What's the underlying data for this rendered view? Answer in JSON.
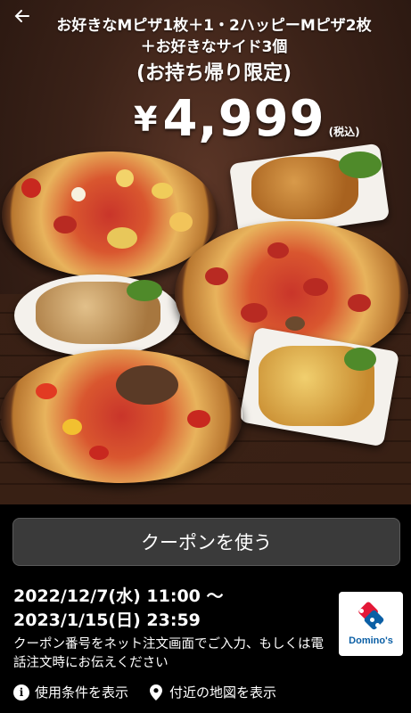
{
  "header": {
    "title_line1": "お好きなMピザ1枚＋1・2ハッピーMピザ2枚",
    "title_line2": "＋お好きなサイド3個",
    "title_line3": "(お持ち帰り限定)"
  },
  "price": {
    "currency": "¥",
    "amount": "4,999",
    "tax_note": "(税込)"
  },
  "coupon": {
    "use_button_label": "クーポンを使う",
    "period_start": "2022/12/7(水) 11:00 ～",
    "period_end": "2023/1/15(日) 23:59",
    "instruction": "クーポン番号をネット注文画面でご入力、もしくは電話注文時にお伝えください"
  },
  "brand": {
    "logo_text": "Domino's",
    "red": "#e31837",
    "blue": "#006491"
  },
  "footer": {
    "terms_label": "使用条件を表示",
    "map_label": "付近の地図を表示"
  },
  "icons": {
    "back": "arrow-left-icon",
    "terms": "info-icon",
    "map": "map-pin-icon"
  }
}
